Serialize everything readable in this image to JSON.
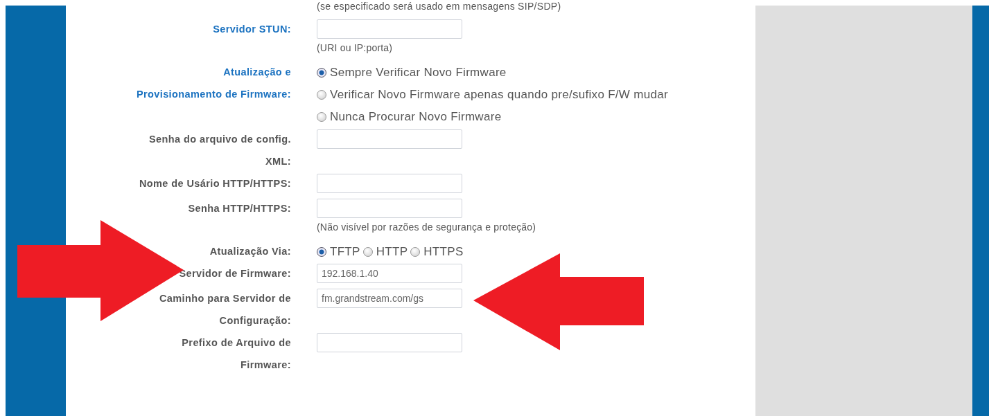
{
  "top_note": "(se especificado será usado em mensagens SIP/SDP)",
  "fields": [
    {
      "kind": "text",
      "label_lines": [
        "Servidor STUN:"
      ],
      "highlighted": true,
      "hint": "(URI ou IP:porta)"
    },
    {
      "kind": "radio",
      "label_lines": [
        "Atualização e",
        "Provisionamento de Firmware:"
      ],
      "highlighted": true,
      "stacked": true,
      "options": [
        {
          "label": "Sempre Verificar Novo Firmware",
          "selected": true
        },
        {
          "label": "Verificar Novo Firmware apenas quando pre/sufixo F/W mudar",
          "selected": false
        },
        {
          "label": "Nunca Procurar Novo Firmware",
          "selected": false
        }
      ]
    },
    {
      "kind": "text",
      "label_lines": [
        "Senha do arquivo de config.",
        "XML:"
      ],
      "highlighted": false
    },
    {
      "kind": "text",
      "label_lines": [
        "Nome de Usário HTTP/HTTPS:"
      ],
      "highlighted": false
    },
    {
      "kind": "text",
      "label_lines": [
        "Senha HTTP/HTTPS:"
      ],
      "highlighted": false,
      "hint": "(Não visível por razões de segurança e proteção)"
    },
    {
      "kind": "radio",
      "label_lines": [
        "Atualização Via:"
      ],
      "highlighted": false,
      "stacked": false,
      "options": [
        {
          "label": "TFTP",
          "selected": true
        },
        {
          "label": "HTTP",
          "selected": false
        },
        {
          "label": "HTTPS",
          "selected": false
        }
      ]
    },
    {
      "kind": "text",
      "label_lines": [
        "Servidor de Firmware:"
      ],
      "highlighted": false,
      "value": "192.168.1.40"
    },
    {
      "kind": "text",
      "label_lines": [
        "Caminho para Servidor de",
        "Configuração:"
      ],
      "highlighted": false,
      "value": "fm.grandstream.com/gs"
    },
    {
      "kind": "text",
      "label_lines": [
        "Prefixo de Arquivo de",
        "Firmware:"
      ],
      "highlighted": false
    }
  ]
}
